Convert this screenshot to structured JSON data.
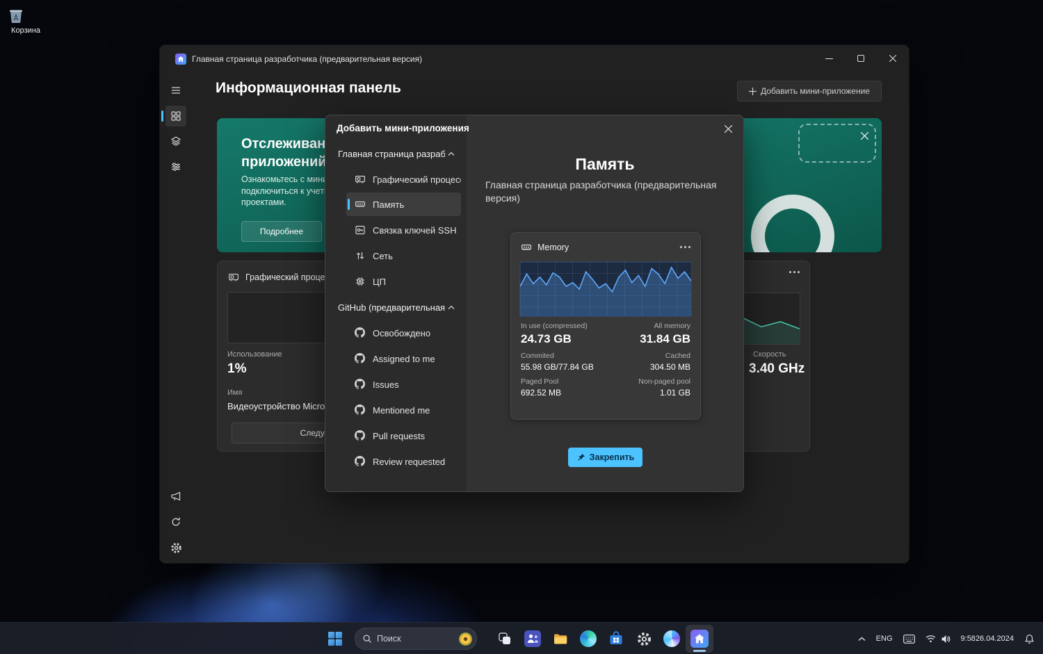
{
  "desktop": {
    "recycle_bin_label": "Корзина"
  },
  "window": {
    "title": "Главная страница разработчика (предварительная версия)",
    "page_title": "Информационная панель",
    "add_widget": {
      "label": "Добавить мини-приложение"
    }
  },
  "cards": {
    "tracking": {
      "title_lines": [
        "Отслеживание",
        "приложений"
      ],
      "body_lines": [
        "Ознакомьтесь с мини-приложениями,",
        "подключиться к учетным записям и",
        "проектами."
      ],
      "button": "Подробнее"
    },
    "gpu": {
      "title": "Графический процессор",
      "usage_label": "Использование",
      "usage_value": "1%",
      "name_label": "Имя",
      "name_value": "Видеоустройство Microsoft",
      "button": "Следующий графический процессор"
    },
    "cpu": {
      "speed_label": "Скорость",
      "speed_value": "3.40 GHz"
    }
  },
  "dialog": {
    "title": "Добавить мини-приложения",
    "groups": [
      {
        "label": "Главная страница разработчика",
        "items": [
          {
            "label": "Графический процессор"
          },
          {
            "label": "Память"
          },
          {
            "label": "Связка ключей SSH"
          },
          {
            "label": "Сеть"
          },
          {
            "label": "ЦП"
          }
        ]
      },
      {
        "label": "GitHub (предварительная версия)",
        "items": [
          {
            "label": "Освобождено"
          },
          {
            "label": "Assigned to me"
          },
          {
            "label": "Issues"
          },
          {
            "label": "Mentioned me"
          },
          {
            "label": "Pull requests"
          },
          {
            "label": "Review requested"
          }
        ]
      }
    ],
    "detail": {
      "title": "Память",
      "subtitle": "Главная страница разработчика (предварительная версия)",
      "widget": {
        "title": "Memory",
        "stats": {
          "in_use_label": "In use (compressed)",
          "in_use_value": "24.73 GB",
          "all_label": "All memory",
          "all_value": "31.84 GB",
          "commited_label": "Commited",
          "commited_value": "55.98 GB/77.84 GB",
          "cached_label": "Cached",
          "cached_value": "304.50 MB",
          "paged_label": "Paged Pool",
          "paged_value": "692.52 MB",
          "nonpaged_label": "Non-paged pool",
          "nonpaged_value": "1.01 GB"
        }
      },
      "pin_button": "Закрепить"
    }
  },
  "taskbar": {
    "search_placeholder": "Поиск",
    "tray": {
      "language": "ENG",
      "time": "9:58",
      "date": "26.04.2024"
    }
  },
  "charts": {
    "memory": [
      55,
      78,
      60,
      72,
      58,
      80,
      72,
      55,
      62,
      50,
      82,
      68,
      52,
      60,
      45,
      72,
      85,
      62,
      75,
      55,
      88,
      78,
      60,
      90,
      70,
      82,
      65
    ],
    "cpu": [
      22,
      52,
      35,
      28,
      58,
      38,
      46,
      30,
      52,
      34,
      44,
      30
    ]
  },
  "colors": {
    "accent": "#4cc2ff",
    "teal_card": "#0f6e5e",
    "memory_line": "#5fa9ff"
  }
}
